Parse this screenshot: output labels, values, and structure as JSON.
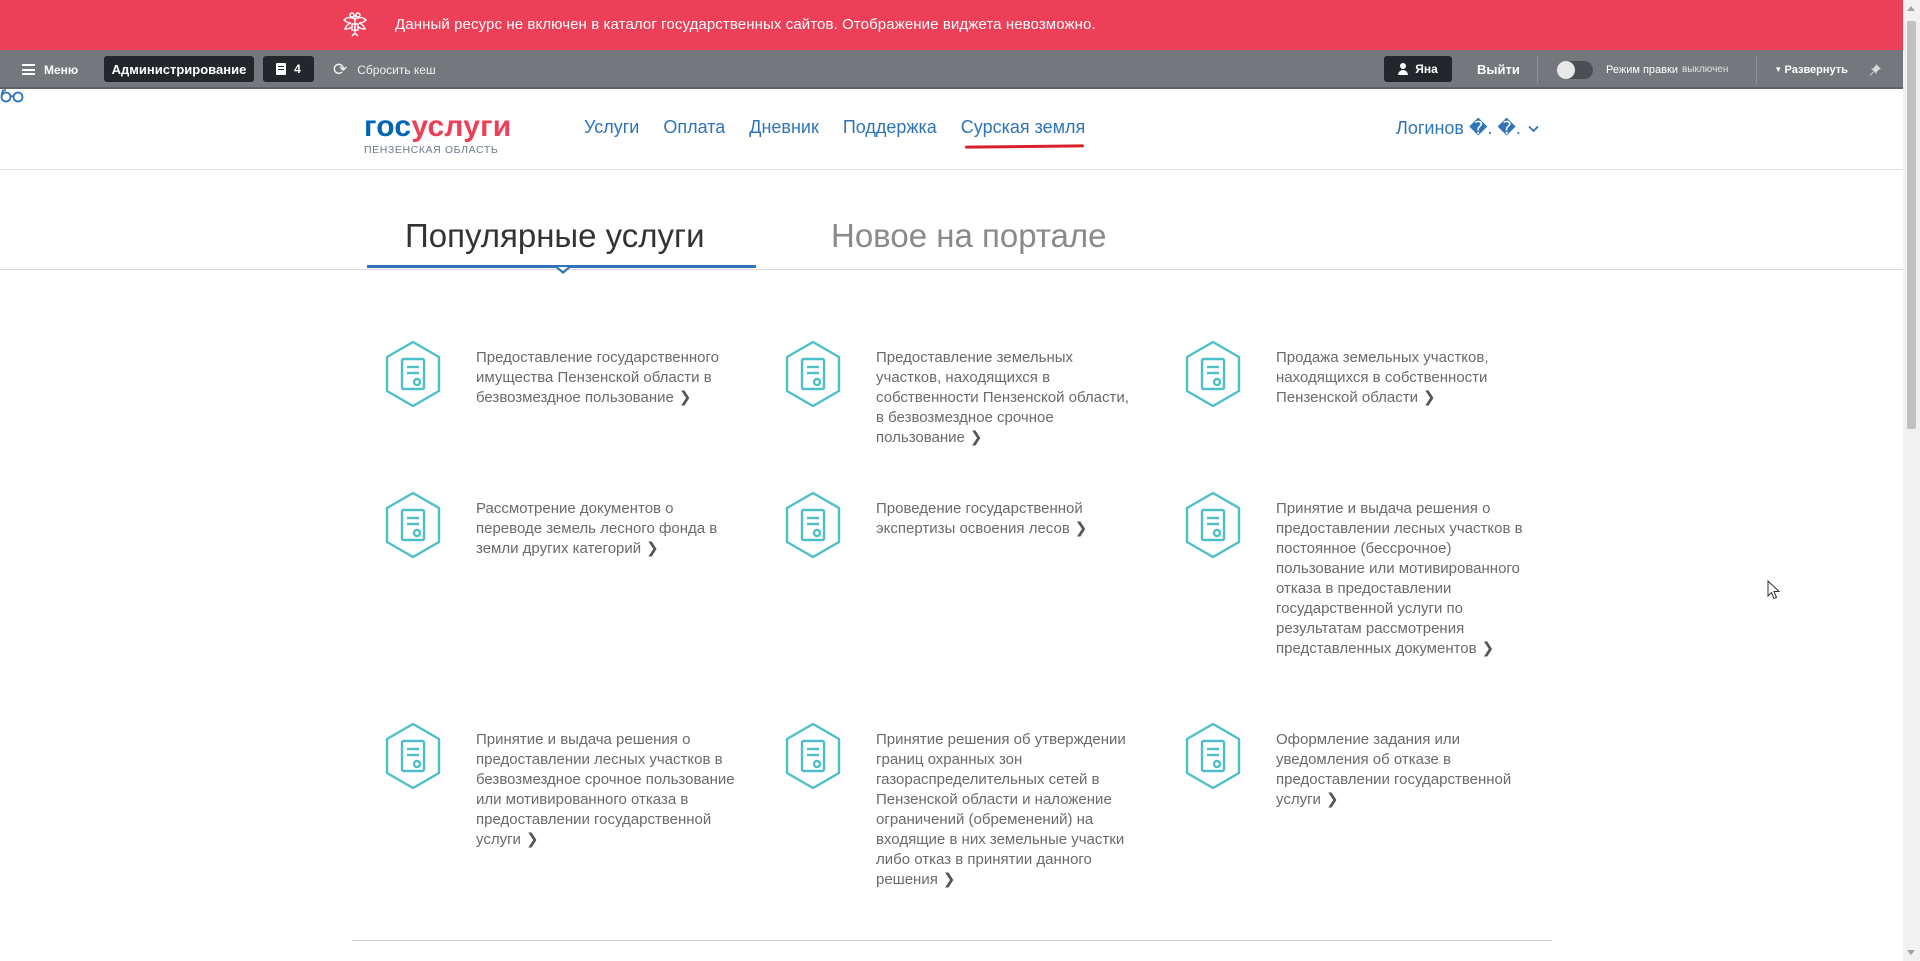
{
  "alert": {
    "text": "Данный ресурс не включен в каталог государственных сайтов. Отображение виджета невозможно."
  },
  "adminbar": {
    "menu_label": "Меню",
    "admin_label": "Администрирование",
    "notifications_count": "4",
    "cache_label": "Сбросить кеш",
    "user_label": "Яна",
    "logout_label": "Выйти",
    "edit_mode_label": "Режим правки",
    "edit_mode_state": "выключен",
    "expand_label": "Развернуть"
  },
  "header": {
    "logo_gos": "гос",
    "logo_uslugi": "услуги",
    "logo_region": "ПЕНЗЕНСКАЯ ОБЛАСТЬ",
    "nav": [
      "Услуги",
      "Оплата",
      "Дневник",
      "Поддержка",
      "Сурская земля"
    ],
    "account": "Логинов �. �."
  },
  "tabs": {
    "popular": "Популярные услуги",
    "new": "Новое на портале"
  },
  "services": [
    "Предоставление государственного имущества Пензенской области в безвозмездное пользование",
    "Предоставление земельных участков, находящихся в собственности Пензенской области, в безвозмездное срочное пользование",
    "Продажа земельных участков, находящихся в собственности Пензенской области",
    "Рассмотрение документов о переводе земель лесного фонда в земли других категорий",
    "Проведение государственной экспертизы освоения лесов",
    "Принятие и выдача решения о предоставлении лесных участков в постоянное (бессрочное) пользование или мотивированного отказа в предоставлении государственной услуги по результатам рассмотрения представленных документов",
    "Принятие и выдача решения о предоставлении лесных участков в безвозмездное срочное пользование или мотивированного отказа в предоставлении государственной услуги",
    "Принятие решения об утверждении границ охранных зон газораспределительных сетей в Пензенской области и наложение ограничений (обременений) на входящие в них земельные участки либо отказ в принятии данного решения",
    "Оформление задания или уведомления об отказе в предоставлении государственной услуги"
  ],
  "colors": {
    "alert_bg": "#ee3f58",
    "adminbar_bg": "#74787d",
    "link": "#2d74b8",
    "icon_teal": "#4dbfc8",
    "underline_red": "#d81f2a"
  }
}
